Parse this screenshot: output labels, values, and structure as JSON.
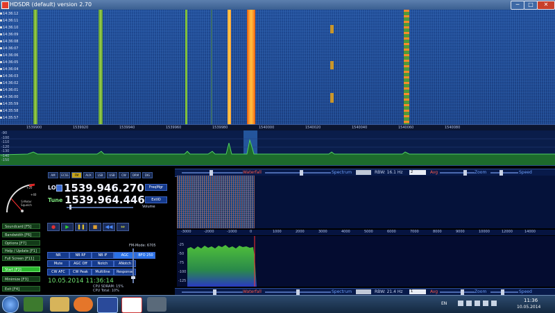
{
  "window": {
    "title": "HDSDR (default)  version 2.70",
    "minimize": "─",
    "maximize": "□",
    "close": "✕"
  },
  "waterfall_main": {
    "row_labels": [
      "14:36:12",
      "14:36:11",
      "14:36:10",
      "14:36:09",
      "14:36:08",
      "14:36:07",
      "14:36:06",
      "14:36:05",
      "14:36:04",
      "14:36:03",
      "14:36:02",
      "14:36:01",
      "14:36:00",
      "14:35:59",
      "14:35:58",
      "14:35:57"
    ],
    "freq_ticks": [
      "1539900",
      "1539920",
      "1539940",
      "1539960",
      "1539980",
      "1540000",
      "1540020",
      "1540040",
      "1540060",
      "1540080"
    ],
    "db_labels": [
      "-90",
      "-100",
      "-110",
      "-120",
      "-130",
      "-140",
      "-150"
    ],
    "colors": {
      "bg": "#1c3f80",
      "green": "#7fbf3a",
      "orange": "#ff7a1a"
    }
  },
  "modes": [
    "AM",
    "ECSS",
    "FM",
    "AUX",
    "LSB",
    "USB",
    "CW",
    "DRM",
    "DIG"
  ],
  "lo": {
    "label": "LO",
    "value": "1539.946.270",
    "button": "FreqMgr"
  },
  "tune": {
    "label": "Tune",
    "value": "1539.964.446",
    "button": "ExtIO"
  },
  "volume": {
    "label": "Volume"
  },
  "smeter": {
    "scale_top": "+20",
    "scale_mid": "+40",
    "caption": "S-Meter\nSquelch"
  },
  "left_buttons": [
    {
      "label": "Soundcard [F5]"
    },
    {
      "label": "Bandwidth [F6]"
    },
    {
      "label": "Options [F7]"
    },
    {
      "label": "Help / Update [F1]"
    },
    {
      "label": "Full Screen [F11]"
    },
    {
      "label": "Start [F2]"
    },
    {
      "label": "Minimize [F3]"
    },
    {
      "label": "Exit [F4]"
    }
  ],
  "transport": [
    "●",
    "▶",
    "❚❚",
    "■",
    "◀◀",
    "⇔"
  ],
  "filter_buttons": [
    [
      "NR",
      "NB RF",
      "NB IF",
      "AGC",
      "BFO 250"
    ],
    [
      "Mute",
      "AGC Off",
      "Notch",
      "ANotch"
    ],
    [
      "CW AFC",
      "CW Peak",
      "Multiline",
      "Response"
    ]
  ],
  "fm_mode": "FM-Mode: 6705",
  "datetime": "10.05.2014 11:36:14",
  "cpu": [
    "CPU SDRAM: 15%",
    "CPU Total: 10%"
  ],
  "top_controls": {
    "waterfall": "Waterfall",
    "spectrum": "Spectrum",
    "rbw": "RBW: 16.1 Hz",
    "avg_value": "2",
    "avg": "Avg",
    "zoom": "Zoom",
    "speed": "Speed"
  },
  "bottom_controls": {
    "waterfall": "Waterfall",
    "spectrum": "Spectrum",
    "rbw": "RBW: 21.4 Hz",
    "avg_value": "1",
    "avg": "Avg",
    "zoom": "Zoom",
    "speed": "Speed"
  },
  "axis2_ticks": [
    "-3000",
    "-2000",
    "-1000",
    "0",
    "1000",
    "2000",
    "3000",
    "4000",
    "5000",
    "6000",
    "7000",
    "8000",
    "9000",
    "10000",
    "12000",
    "14000"
  ],
  "spec2_db": [
    "-25",
    "-50",
    "-75",
    "-100",
    "-125"
  ],
  "taskbar": {
    "lang": "EN",
    "time": "11:36",
    "date": "10.05.2014"
  }
}
